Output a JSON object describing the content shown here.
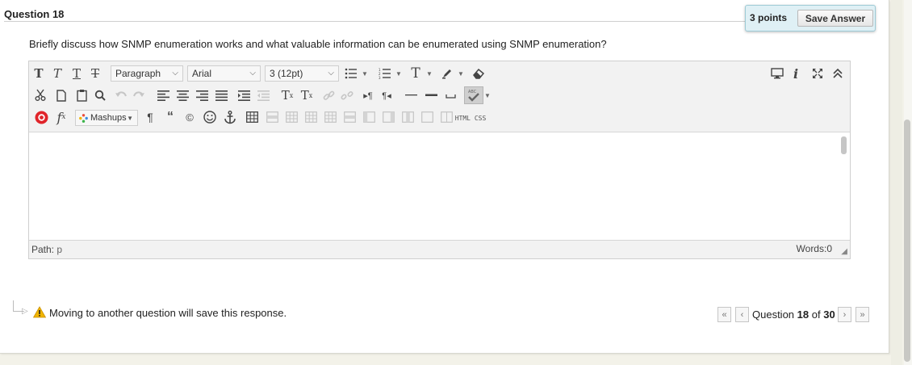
{
  "question": {
    "title": "Question 18",
    "points": "3 points",
    "save_button": "Save Answer",
    "prompt": "Briefly discuss how SNMP enumeration works and what valuable information can be enumerated using SNMP enumeration?"
  },
  "editor": {
    "format_select": "Paragraph",
    "font_select": "Arial",
    "size_select": "3 (12pt)",
    "mashups_label": "Mashups",
    "html_label": "HTML",
    "css_label": "CSS",
    "path_label": "Path:",
    "path_value": "p",
    "words_label": "Words:0"
  },
  "footer": {
    "save_note": "Moving to another question will save this response.",
    "pager_prefix": "Question",
    "current": "18",
    "of": "of",
    "total": "30"
  },
  "icons": {
    "warning": "warning-icon",
    "first": "first-page-icon",
    "prev": "prev-page-icon",
    "next": "next-page-icon",
    "last": "last-page-icon"
  },
  "colors": {
    "points_bg": "#dff0f5",
    "warning": "#f0b400"
  }
}
